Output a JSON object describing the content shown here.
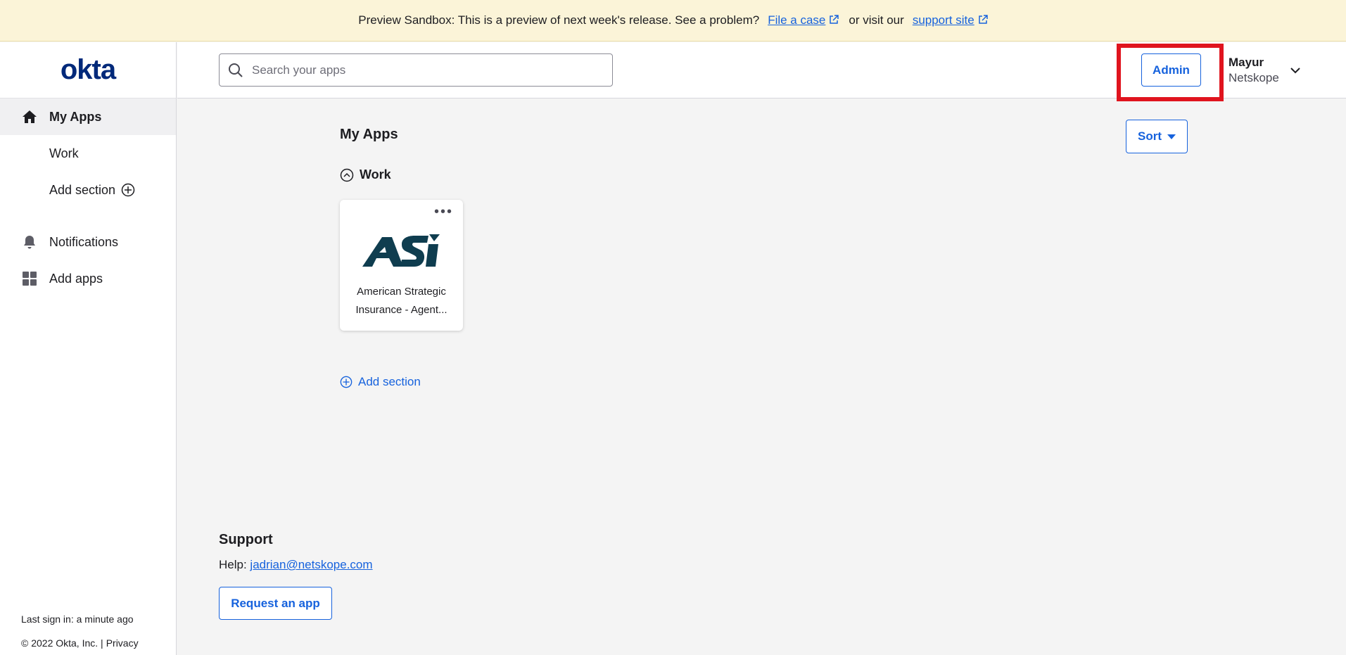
{
  "banner": {
    "text": "Preview Sandbox: This is a preview of next week's release. See a problem?",
    "link1": "File a case",
    "middle": "or visit our",
    "link2": "support site"
  },
  "logo": "okta",
  "sidebar": {
    "items": [
      {
        "label": "My Apps",
        "icon": "home-icon"
      },
      {
        "label": "Work"
      },
      {
        "label": "Add section",
        "icon": "plus-circle-icon"
      },
      {
        "label": "Notifications",
        "icon": "bell-icon"
      },
      {
        "label": "Add apps",
        "icon": "grid-icon"
      }
    ],
    "last_sign_in": "Last sign in: a minute ago",
    "copyright": "© 2022 Okta, Inc. |",
    "privacy": "Privacy"
  },
  "header": {
    "search_placeholder": "Search your apps",
    "admin_label": "Admin",
    "user_name": "Mayur",
    "user_org": "Netskope"
  },
  "main": {
    "title": "My Apps",
    "sort_label": "Sort",
    "section_title": "Work",
    "apps": [
      {
        "name": "American Strategic Insurance - Agent...",
        "logo_text": "ASI"
      }
    ],
    "add_section_label": "Add section"
  },
  "support": {
    "title": "Support",
    "help_prefix": "Help:",
    "help_email": "jadrian@netskope.com",
    "request_label": "Request an app"
  },
  "colors": {
    "accent": "#1662dd",
    "banner_bg": "#fbf4d8",
    "highlight": "#e0141e",
    "logo": "#00297a"
  }
}
